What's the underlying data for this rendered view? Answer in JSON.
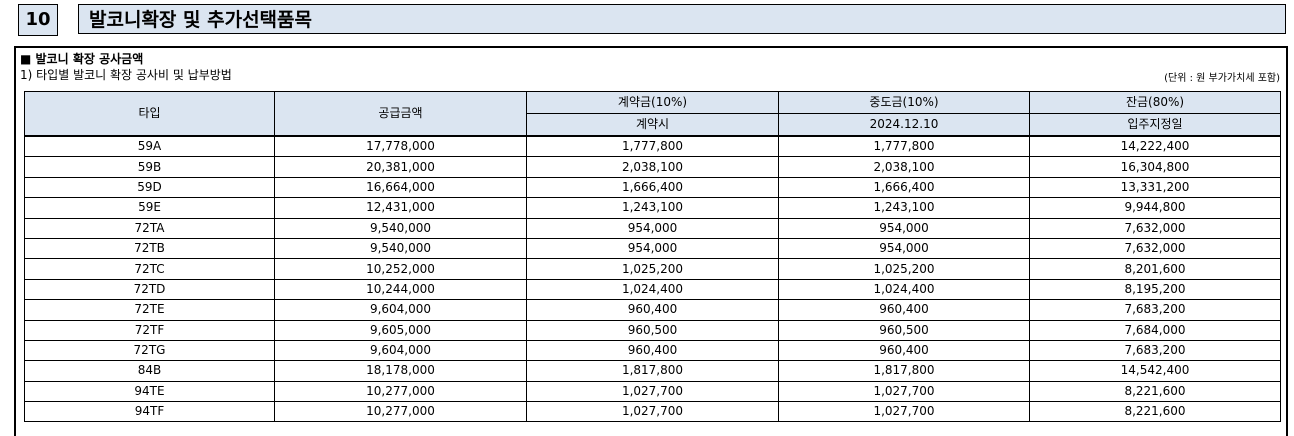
{
  "section_number": "10",
  "section_heading": "발코니확장 및 추가선택품목",
  "block_title": "■ 발코니 확장 공사금액",
  "subtitle": "1) 타입별 발코니 확장 공사비 및 납부방법",
  "unit_note": "(단위 : 원  부가가치세 포함)",
  "table": {
    "col_type": "타입",
    "col_supply": "공급금액",
    "col_deposit": "계약금(10%)",
    "col_deposit_sub": "계약시",
    "col_interim": "중도금(10%)",
    "col_interim_sub": "2024.12.10",
    "col_balance": "잔금(80%)",
    "col_balance_sub": "입주지정일",
    "rows": [
      [
        "59A",
        "17,778,000",
        "1,777,800",
        "1,777,800",
        "14,222,400"
      ],
      [
        "59B",
        "20,381,000",
        "2,038,100",
        "2,038,100",
        "16,304,800"
      ],
      [
        "59D",
        "16,664,000",
        "1,666,400",
        "1,666,400",
        "13,331,200"
      ],
      [
        "59E",
        "12,431,000",
        "1,243,100",
        "1,243,100",
        "9,944,800"
      ],
      [
        "72TA",
        "9,540,000",
        "954,000",
        "954,000",
        "7,632,000"
      ],
      [
        "72TB",
        "9,540,000",
        "954,000",
        "954,000",
        "7,632,000"
      ],
      [
        "72TC",
        "10,252,000",
        "1,025,200",
        "1,025,200",
        "8,201,600"
      ],
      [
        "72TD",
        "10,244,000",
        "1,024,400",
        "1,024,400",
        "8,195,200"
      ],
      [
        "72TE",
        "9,604,000",
        "960,400",
        "960,400",
        "7,683,200"
      ],
      [
        "72TF",
        "9,605,000",
        "960,500",
        "960,500",
        "7,684,000"
      ],
      [
        "72TG",
        "9,604,000",
        "960,400",
        "960,400",
        "7,683,200"
      ],
      [
        "84B",
        "18,178,000",
        "1,817,800",
        "1,817,800",
        "14,542,400"
      ],
      [
        "94TE",
        "10,277,000",
        "1,027,700",
        "1,027,700",
        "8,221,600"
      ],
      [
        "94TF",
        "10,277,000",
        "1,027,700",
        "1,027,700",
        "8,221,600"
      ]
    ]
  }
}
